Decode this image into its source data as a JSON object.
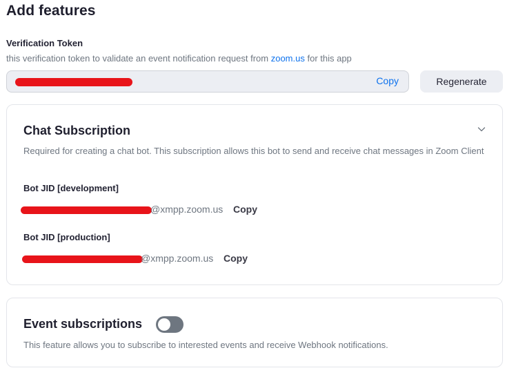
{
  "page": {
    "title": "Add features"
  },
  "verification": {
    "label": "Verification Token",
    "desc_prefix": "this verification token to validate an event notification request from ",
    "desc_link": "zoom.us",
    "desc_suffix": " for this app",
    "token_value": "",
    "copy_label": "Copy",
    "regenerate_label": "Regenerate"
  },
  "chat_subscription": {
    "title": "Chat Subscription",
    "description": "Required for creating a chat bot. This subscription allows this bot to send and receive chat messages in Zoom Client",
    "development": {
      "label": "Bot JID [development]",
      "value_suffix": "@xmpp.zoom.us",
      "copy_label": "Copy"
    },
    "production": {
      "label": "Bot JID [production]",
      "value_suffix": "@xmpp.zoom.us",
      "copy_label": "Copy"
    },
    "expanded": true
  },
  "event_subscriptions": {
    "title": "Event subscriptions",
    "enabled": false,
    "description": "This feature allows you to subscribe to interested events and receive Webhook notifications."
  },
  "colors": {
    "accent": "#0e72ed",
    "redaction": "#e8141a",
    "toggle_off": "#6e7680"
  },
  "icons": {
    "collapse": "chevron-down-icon"
  }
}
